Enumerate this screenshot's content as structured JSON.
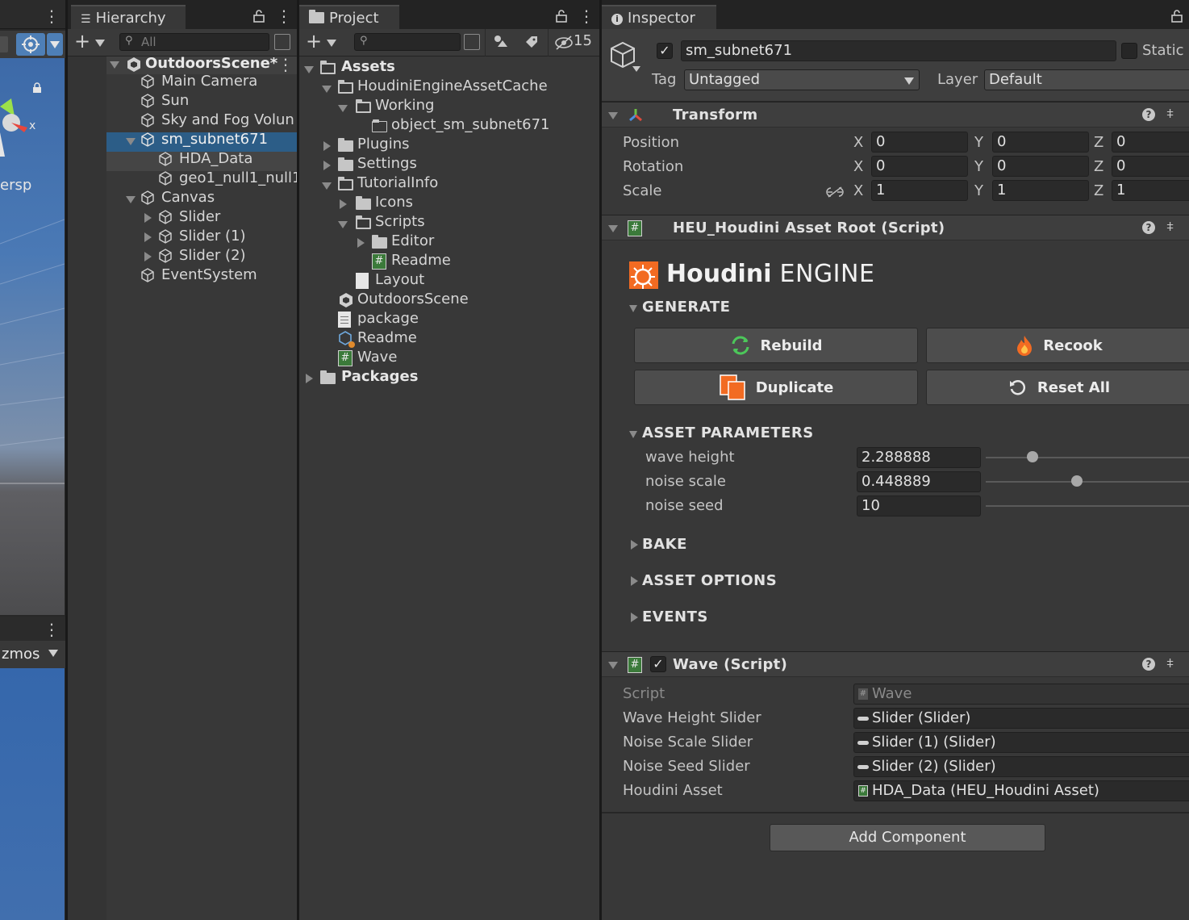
{
  "scene": {
    "perspective_fragment": "ersp",
    "gizmos_fragment": "zmos",
    "axis_x": "x"
  },
  "hierarchy": {
    "tab_label": "Hierarchy",
    "search_placeholder": "All",
    "scene_name": "OutdoorsScene*",
    "items": [
      {
        "label": "Main Camera"
      },
      {
        "label": "Sun"
      },
      {
        "label": "Sky and Fog Volun"
      },
      {
        "label": "sm_subnet671"
      },
      {
        "label": "HDA_Data"
      },
      {
        "label": "geo1_null1_null1_"
      },
      {
        "label": "Canvas"
      },
      {
        "label": "Slider"
      },
      {
        "label": "Slider (1)"
      },
      {
        "label": "Slider (2)"
      },
      {
        "label": "EventSystem"
      }
    ]
  },
  "project": {
    "tab_label": "Project",
    "hidden_count": "15",
    "items": [
      {
        "label": "Assets"
      },
      {
        "label": "HoudiniEngineAssetCache"
      },
      {
        "label": "Working"
      },
      {
        "label": "object_sm_subnet671"
      },
      {
        "label": "Plugins"
      },
      {
        "label": "Settings"
      },
      {
        "label": "TutorialInfo"
      },
      {
        "label": "Icons"
      },
      {
        "label": "Scripts"
      },
      {
        "label": "Editor"
      },
      {
        "label": "Readme"
      },
      {
        "label": "Layout"
      },
      {
        "label": "OutdoorsScene"
      },
      {
        "label": "package"
      },
      {
        "label": "Readme"
      },
      {
        "label": "Wave"
      },
      {
        "label": "Packages"
      }
    ]
  },
  "inspector": {
    "tab_label": "Inspector",
    "object_name": "sm_subnet671",
    "static_label": "Static",
    "tag_label": "Tag",
    "tag_value": "Untagged",
    "layer_label": "Layer",
    "layer_value": "Default",
    "transform": {
      "title": "Transform",
      "position_label": "Position",
      "rotation_label": "Rotation",
      "scale_label": "Scale",
      "axis_x": "X",
      "axis_y": "Y",
      "axis_z": "Z",
      "position": [
        "0",
        "0",
        "0"
      ],
      "rotation": [
        "0",
        "0",
        "0"
      ],
      "scale": [
        "1",
        "1",
        "1"
      ]
    },
    "heu": {
      "title": "HEU_Houdini Asset Root (Script)",
      "logo_bold": "Houdini",
      "logo_rest": " ENGINE",
      "generate_label": "GENERATE",
      "rebuild_label": "Rebuild",
      "recook_label": "Recook",
      "duplicate_label": "Duplicate",
      "reset_label": "Reset All",
      "asset_params_label": "ASSET PARAMETERS",
      "params": [
        {
          "label": "wave height",
          "value": "2.288888",
          "fraction": 0.23
        },
        {
          "label": "noise scale",
          "value": "0.448889",
          "fraction": 0.45
        },
        {
          "label": "noise seed",
          "value": "10",
          "fraction": null
        }
      ],
      "bake_label": "BAKE",
      "asset_options_label": "ASSET OPTIONS",
      "events_label": "EVENTS"
    },
    "wave": {
      "title": "Wave (Script)",
      "fields": [
        {
          "label": "Script",
          "value": "Wave"
        },
        {
          "label": "Wave Height Slider",
          "value": "Slider (Slider)"
        },
        {
          "label": "Noise Scale Slider",
          "value": "Slider (1) (Slider)"
        },
        {
          "label": "Noise Seed Slider",
          "value": "Slider (2) (Slider)"
        },
        {
          "label": "Houdini Asset",
          "value": "HDA_Data (HEU_Houdini Asset)"
        }
      ]
    },
    "add_component_label": "Add Component"
  },
  "colors": {
    "selection": "#2c5d87",
    "panel": "#383838",
    "header": "#3e3e3e",
    "houdini_orange": "#f26b22"
  }
}
